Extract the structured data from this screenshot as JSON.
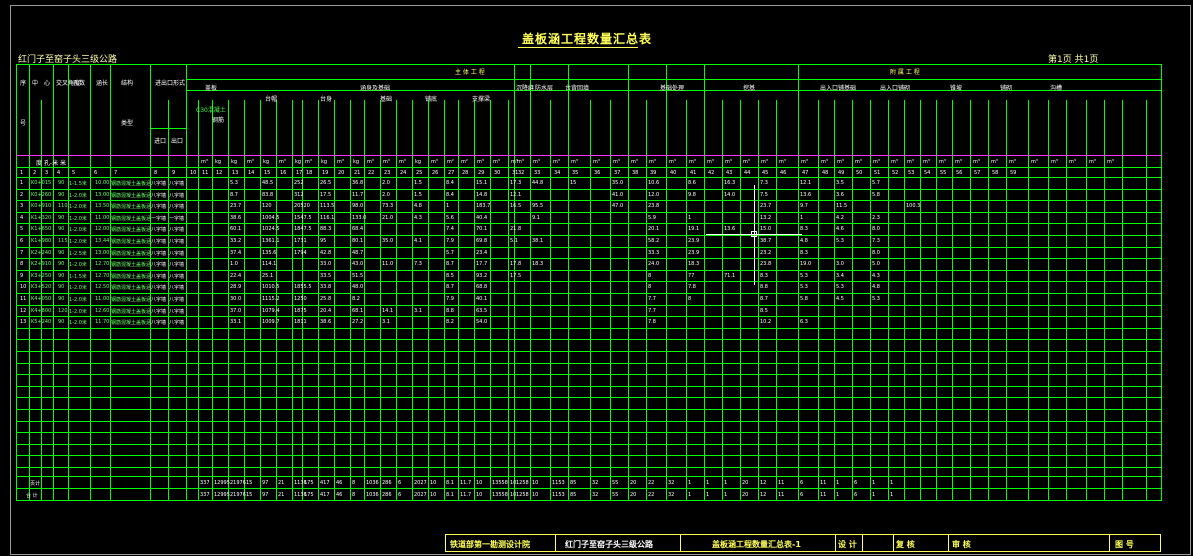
{
  "document": {
    "title": "盖板涵工程数量汇总表",
    "route": "红门子至窑子头三级公路",
    "page": "第1页 共1页"
  },
  "header": {
    "main_group": "主 体 工 程",
    "aux_group": "附 属 工 程",
    "col_labels": {
      "seq": "序",
      "no": "号",
      "center": "中",
      "station": "心",
      "pile": "桩号",
      "angle": "交叉角度",
      "holes": "孔数",
      "length": "涵长",
      "structure": "结构",
      "type": "类型",
      "inlet_outlet": "进出口形式",
      "inlet": "进口",
      "outlet": "出口",
      "cover": "盖板",
      "foundation": "涵身及基础",
      "cap": "台帽",
      "body": "台身",
      "base": "基础",
      "pave": "铺底",
      "support": "支撑梁",
      "settle": "沉降缝",
      "waterproof": "防水层",
      "backfill": "台背回填",
      "treat": "基础处理",
      "earth": "挖基",
      "in_out_works": "出入口铺基础",
      "in_out_pave": "出入口铺砌",
      "slope": "锥坡",
      "paving": "铺砌",
      "channel": "沟槽",
      "unit_row": "度 孔-米 米",
      "c30": "C30混凝土",
      "steel": "钢筋"
    },
    "units": [
      "m³",
      "kg",
      "kg",
      "m³",
      "kg",
      "m³",
      "kg",
      "m³",
      "kg",
      "m³",
      "kg",
      "m³",
      "m³",
      "m³",
      "kg",
      "m³",
      "m²",
      "m²",
      "m³",
      "m³",
      "m³",
      "m³",
      "m³",
      "m³",
      "m³",
      "m³",
      "m³",
      "m³",
      "m³",
      "m³",
      "m³",
      "m³",
      "m³",
      "m³",
      "m³",
      "m³",
      "m³",
      "m³",
      "m³",
      "m³",
      "m³",
      "m³",
      "m³",
      "m³",
      "m³",
      "m³",
      "m³",
      "m³",
      "m³",
      "m³",
      "m³",
      "m³",
      "m³",
      "m³"
    ],
    "col_numbers": [
      "1",
      "2",
      "3",
      "4",
      "5",
      "6",
      "7",
      "8",
      "9",
      "10",
      "11",
      "12",
      "13",
      "14",
      "15",
      "16",
      "17",
      "18",
      "19",
      "20",
      "21",
      "22",
      "23",
      "24",
      "25",
      "26",
      "27",
      "28",
      "29",
      "30",
      "31",
      "32",
      "33",
      "34",
      "35",
      "36",
      "37",
      "38",
      "39",
      "40",
      "41",
      "42",
      "43",
      "44",
      "45",
      "46",
      "47",
      "48",
      "49",
      "50",
      "51",
      "52",
      "53",
      "54",
      "55",
      "56",
      "57",
      "58",
      "59"
    ]
  },
  "rows": [
    {
      "no": "1",
      "pile": "K0+015",
      "angle": "90",
      "holes": "1-1.5米",
      "len": "10.00",
      "type": "钢筋混凝土盖板涵",
      "in": "八字墙",
      "out": "八字墙",
      "v1": "5.3",
      "v2": "48.5",
      "v3": "252",
      "v4": "26.5",
      "v5": "36.8",
      "v6": "2.0",
      "v7": "1.5",
      "v8": "8.4",
      "v9": "15.1",
      "v10": "17.3",
      "v11": "44.8",
      "v12": "15",
      "v13": "35.0",
      "v14": "10.6",
      "v15": "8.6",
      "v16": "16.3",
      "v17": "7.3",
      "v18": "12.1",
      "v19": "3.5",
      "v20": "5.7"
    },
    {
      "no": "2",
      "pile": "K0+260",
      "angle": "90",
      "holes": "1-2.0米",
      "len": "13.00",
      "type": "钢筋混凝土盖板涵",
      "in": "八字墙",
      "out": "八字墙",
      "v1": "8.7",
      "v2": "83.8",
      "v3": "312",
      "v4": "17.5",
      "v5": "11.7",
      "v6": "2.0",
      "v7": "1.5",
      "v8": "8.4",
      "v9": "14.8",
      "v10": "12.1",
      "v11": "",
      "v12": "",
      "v13": "41.0",
      "v14": "12.0",
      "v15": "9.8",
      "v16": "14.0",
      "v17": "7.5",
      "v18": "13.6",
      "v19": "3.6",
      "v20": "5.8"
    },
    {
      "no": "3",
      "pile": "K0+910",
      "angle": "110",
      "holes": "1-2.0米",
      "len": "13.50",
      "type": "钢筋混凝土盖板涵",
      "in": "八字墙",
      "out": "八字墙",
      "v1": "23.7",
      "v2": "120",
      "v3": "20520",
      "v4": "113.5",
      "v5": "98.0",
      "v6": "73.3",
      "v7": "4.8",
      "v8": "1",
      "v9": "183.7",
      "v10": "16.5",
      "v11": "95.5",
      "v12": "",
      "v13": "47.0",
      "v14": "23.8",
      "v15": "",
      "v16": "",
      "v17": "23.7",
      "v18": "9.7",
      "v19": "11.5",
      "v20": "",
      "v21": "100.3"
    },
    {
      "no": "4",
      "pile": "K1+320",
      "angle": "90",
      "holes": "1-2.0米",
      "len": "11.00",
      "type": "钢筋混凝土盖板涵",
      "in": "一字墙",
      "out": "一字墙",
      "v1": "38.6",
      "v2": "1004.5",
      "v3": "1547.5",
      "v4": "116.1",
      "v5": "133.0",
      "v6": "21.0",
      "v7": "4.3",
      "v8": "5.6",
      "v9": "40.4",
      "v10": "",
      "v11": "9.1",
      "v12": "",
      "v13": "",
      "v14": "5.9",
      "v15": "1",
      "v16": "",
      "v17": "13.2",
      "v18": "1",
      "v19": "4.2",
      "v20": "2.3"
    },
    {
      "no": "5",
      "pile": "K1+650",
      "angle": "90",
      "holes": "1-2.0米",
      "len": "12.00",
      "type": "钢筋混凝土盖板涵",
      "in": "八字墙",
      "out": "八字墙",
      "v1": "60.1",
      "v2": "1024.5",
      "v3": "1847.5",
      "v4": "88.3",
      "v5": "68.4",
      "v6": "",
      "v7": "",
      "v8": "7.4",
      "v9": "70.1",
      "v10": "21.8",
      "v11": "",
      "v12": "",
      "v13": "",
      "v14": "20.1",
      "v15": "19.1",
      "v16": "13.6",
      "v17": "15.0",
      "v18": "8.3",
      "v19": "4.6",
      "v20": "8.0"
    },
    {
      "no": "6",
      "pile": "K1+980",
      "angle": "115",
      "holes": "1-2.0米",
      "len": "13.44",
      "type": "钢筋混凝土盖板涵",
      "in": "八字墙",
      "out": "八字墙",
      "v1": "33.2",
      "v2": "1361.1",
      "v3": "1731",
      "v4": "95",
      "v5": "80.1",
      "v6": "35.0",
      "v7": "4.1",
      "v8": "7.9",
      "v9": "69.8",
      "v10": "5.1",
      "v11": "38.1",
      "v12": "",
      "v13": "",
      "v14": "58.2",
      "v15": "23.9",
      "v16": "",
      "v17": "38.7",
      "v18": "4.8",
      "v19": "5.3",
      "v20": "7.3"
    },
    {
      "no": "7",
      "pile": "K2+240",
      "angle": "90",
      "holes": "1-2.5米",
      "len": "13.00",
      "type": "钢筋混凝土盖板涵",
      "in": "八字墙",
      "out": "八字墙",
      "v1": "37.4",
      "v2": "135.6",
      "v3": "1794",
      "v4": "42.8",
      "v5": "48.7",
      "v6": "",
      "v7": "",
      "v8": "5.7",
      "v9": "23.4",
      "v10": "",
      "v11": "",
      "v12": "",
      "v13": "",
      "v14": "33.3",
      "v15": "23.9",
      "v16": "",
      "v17": "23.2",
      "v18": "8.3",
      "v19": "",
      "v20": "8.0"
    },
    {
      "no": "8",
      "pile": "K2+910",
      "angle": "90",
      "holes": "1-2.0米",
      "len": "12.70",
      "type": "钢筋混凝土盖板涵",
      "in": "八字墙",
      "out": "八字墙",
      "v1": "1.0",
      "v2": "114.1",
      "v3": "",
      "v4": "33.0",
      "v5": "43.0",
      "v6": "11.0",
      "v7": "7.3",
      "v8": "8.7",
      "v9": "17.7",
      "v10": "17.8",
      "v11": "18.3",
      "v12": "",
      "v13": "",
      "v14": "24.0",
      "v15": "18.3",
      "v16": "",
      "v17": "23.8",
      "v18": "19.0",
      "v19": "3.0",
      "v20": "5.0"
    },
    {
      "no": "9",
      "pile": "K3+250",
      "angle": "90",
      "holes": "1-1.5米",
      "len": "12.70",
      "type": "钢筋混凝土盖板涵",
      "in": "八字墙",
      "out": "八字墙",
      "v1": "22.4",
      "v2": "25.1",
      "v3": "",
      "v4": "33.5",
      "v5": "51.5",
      "v6": "",
      "v7": "",
      "v8": "8.5",
      "v9": "93.2",
      "v10": "17.5",
      "v11": "",
      "v12": "",
      "v13": "",
      "v14": "8",
      "v15": "77",
      "v16": "71.1",
      "v17": "8.3",
      "v18": "5.3",
      "v19": "3.4",
      "v20": "4.3"
    },
    {
      "no": "10",
      "pile": "K3+520",
      "angle": "90",
      "holes": "1-2.0米",
      "len": "12.50",
      "type": "钢筋混凝土盖板涵",
      "in": "八字墙",
      "out": "八字墙",
      "v1": "28.9",
      "v2": "1010.5",
      "v3": "1855.5",
      "v4": "33.8",
      "v5": "48.0",
      "v6": "",
      "v7": "",
      "v8": "8.7",
      "v9": "68.8",
      "v10": "",
      "v11": "",
      "v12": "",
      "v13": "",
      "v14": "8",
      "v15": "7.8",
      "v16": "",
      "v17": "8.8",
      "v18": "5.3",
      "v19": "5.3",
      "v20": "4.8"
    },
    {
      "no": "11",
      "pile": "K4+050",
      "angle": "90",
      "holes": "1-2.0米",
      "len": "11.00",
      "type": "钢筋混凝土盖板涵",
      "in": "八字墙",
      "out": "八字墙",
      "v1": "30.0",
      "v2": "1115.2",
      "v3": "1250",
      "v4": "25.8",
      "v5": "8.2",
      "v6": "",
      "v7": "",
      "v8": "7.9",
      "v9": "40.1",
      "v10": "",
      "v11": "",
      "v12": "",
      "v13": "",
      "v14": "7.7",
      "v15": "8",
      "v16": "",
      "v17": "8.7",
      "v18": "5.8",
      "v19": "4.5",
      "v20": "5.3"
    },
    {
      "no": "12",
      "pile": "K4+800",
      "angle": "120",
      "holes": "1-2.0米",
      "len": "12.60",
      "type": "钢筋混凝土盖板涵",
      "in": "八字墙",
      "out": "八字墙",
      "v1": "37.0",
      "v2": "1079.4",
      "v3": "1875",
      "v4": "20.4",
      "v5": "68.1",
      "v6": "14.1",
      "v7": "3.1",
      "v8": "8.8",
      "v9": "63.5",
      "v10": "",
      "v11": "",
      "v12": "",
      "v13": "",
      "v14": "7.7",
      "v15": "",
      "v16": "",
      "v17": "8.5",
      "v18": "",
      "v19": "",
      "v20": ""
    },
    {
      "no": "13",
      "pile": "K5+240",
      "angle": "90",
      "holes": "1-2.0米",
      "len": "11.70",
      "type": "钢筋混凝土盖板涵",
      "in": "八字墙",
      "out": "八字墙",
      "v1": "33.1",
      "v2": "1009.7",
      "v3": "1811",
      "v4": "38.6",
      "v5": "27.2",
      "v6": "3.1",
      "v7": "",
      "v8": "8.2",
      "v9": "54.0",
      "v10": "",
      "v11": "",
      "v12": "",
      "v13": "",
      "v14": "7.8",
      "v15": "",
      "v16": "",
      "v17": "10.2",
      "v18": "6.3",
      "v19": "",
      "v20": ""
    }
  ],
  "totals": {
    "label_1": "页计",
    "label_2": "合 计",
    "vals": [
      "337",
      "12995",
      "21976",
      "15",
      "97",
      "21",
      "1136",
      "175",
      "417",
      "46",
      "8",
      "1036",
      "286",
      "6",
      "2027",
      "10",
      "8.1",
      "11.7",
      "10",
      "13558",
      "10",
      "1258",
      "10",
      "1153",
      "85",
      "32",
      "55",
      "20",
      "22",
      "32",
      "1",
      "1",
      "1",
      "20",
      "12",
      "11",
      "6",
      "11",
      "1",
      "6",
      "1",
      "1"
    ]
  },
  "footer": {
    "org": "铁道部第一勘测设计院",
    "route": "红门子至窑子头三级公路",
    "doc": "盖板涵工程数量汇总表-1",
    "design": "设 计",
    "review": "复 核",
    "audit": "审 核",
    "drawing_no": "图 号"
  }
}
